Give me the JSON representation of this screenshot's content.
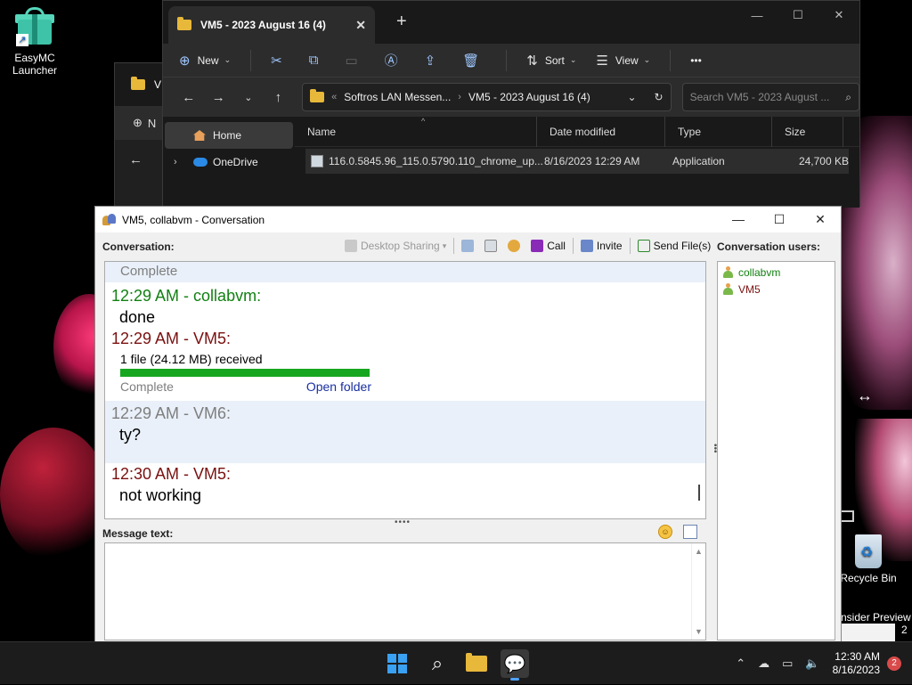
{
  "desktop": {
    "icons": [
      {
        "label_line1": "EasyMC",
        "label_line2": "Launcher"
      },
      {
        "label_line1": "Recycle Bin"
      }
    ],
    "insider_text": "nsider Preview",
    "insider_text2": "2"
  },
  "explorer_back": {
    "tab_label": "V",
    "button_label": "N"
  },
  "explorer": {
    "tab_title": "VM5 - 2023 August 16 (4)",
    "tab_close": "✕",
    "new_tab": "+",
    "window_controls": {
      "minimize": "—",
      "maximize": "☐",
      "close": "✕"
    },
    "commands": {
      "new": "New",
      "sort": "Sort",
      "view": "View",
      "more": "•••"
    },
    "address": {
      "crumb_overflow": "«",
      "crumb1": "Softros LAN Messen...",
      "crumb2": "VM5 - 2023 August 16 (4)"
    },
    "search_placeholder": "Search VM5 - 2023 August ...",
    "nav": {
      "home": "Home",
      "onedrive": "OneDrive"
    },
    "columns": {
      "name": "Name",
      "date": "Date modified",
      "type": "Type",
      "size": "Size"
    },
    "files": [
      {
        "name": "116.0.5845.96_115.0.5790.110_chrome_up...",
        "date": "8/16/2023 12:29 AM",
        "type": "Application",
        "size": "24,700 KB"
      }
    ]
  },
  "conversation": {
    "title": "VM5, collabvm - Conversation",
    "window_controls": {
      "minimize": "—",
      "maximize": "☐",
      "close": "✕"
    },
    "conversation_label": "Conversation:",
    "users_label": "Conversation users:",
    "message_label": "Message text:",
    "toolbar": {
      "desktop_sharing": "Desktop Sharing",
      "call": "Call",
      "invite": "Invite",
      "send_files": "Send File(s)"
    },
    "messages": {
      "top_status": "Complete",
      "m1_header": "12:29 AM - collabvm:",
      "m1_body": "done",
      "m2_header": "12:29 AM - VM5:",
      "m2_file": "1 file (24.12 MB) received",
      "m2_progress": 1.0,
      "m2_status": "Complete",
      "m2_link": "Open folder",
      "m3_header": "12:29 AM - VM6:",
      "m3_body": "ty?",
      "m4_header": "12:30 AM - VM5:",
      "m4_body": "not working"
    },
    "users": [
      "collabvm",
      "VM5"
    ],
    "colors": {
      "collabvm": "#128012",
      "vm5": "#7a1010",
      "progress": "#17a620"
    }
  },
  "taskbar": {
    "apps": [
      "start",
      "search",
      "file-explorer",
      "softros-messenger"
    ],
    "time": "12:30 AM",
    "date": "8/16/2023",
    "notifications": "2"
  }
}
